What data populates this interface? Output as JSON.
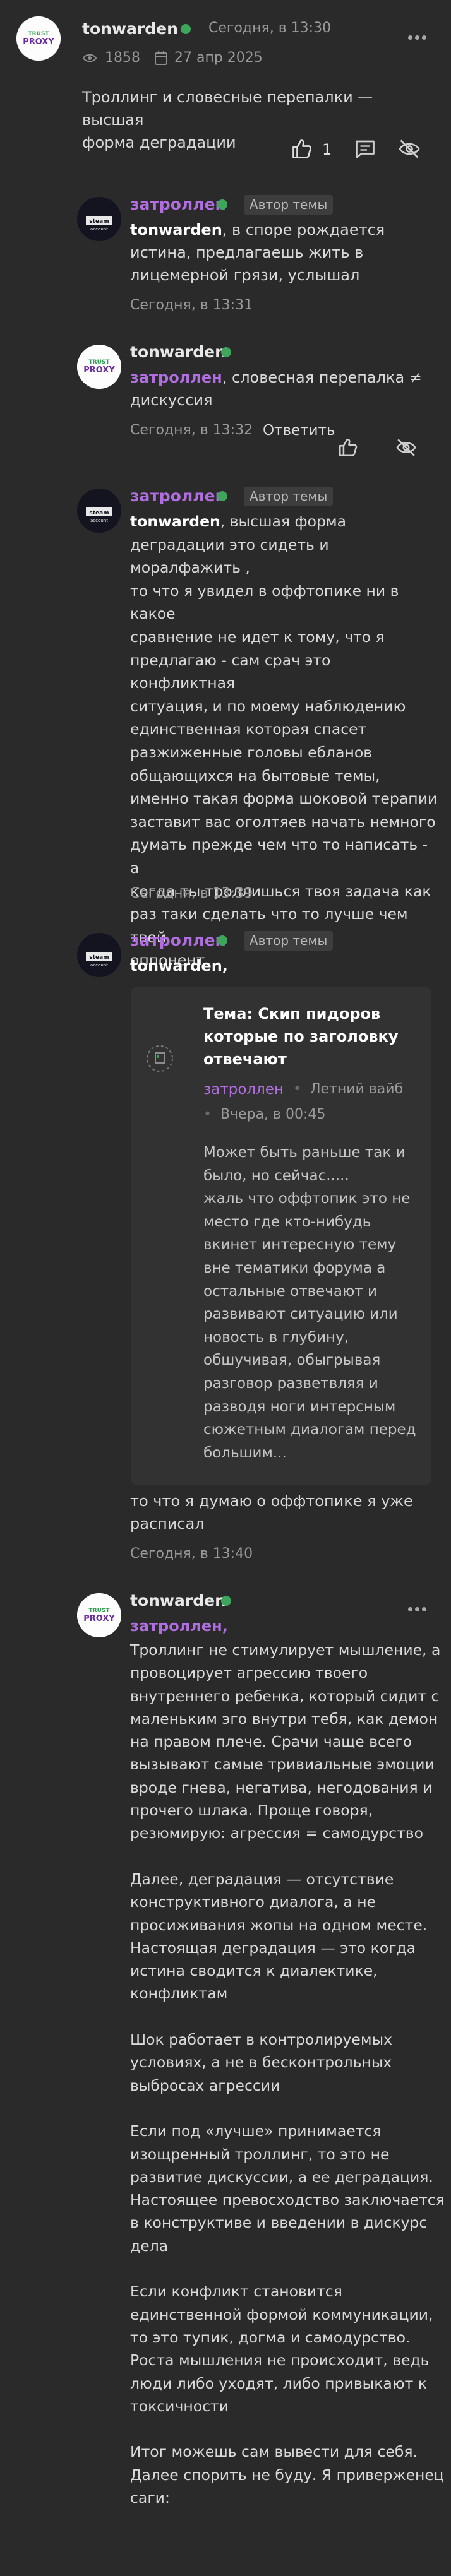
{
  "main_post": {
    "author": "tonwarden",
    "time": "Сегодня, в 13:30",
    "views": "1858",
    "date": "27 апр 2025",
    "text_lines": [
      "Троллинг и словесные перепалки — высшая",
      "форма деградации"
    ],
    "likes": "1"
  },
  "comments": [
    {
      "author": "затроллен",
      "badge": "Автор темы",
      "lines": [
        {
          "bold": "tonwarden",
          "rest": ", в споре рождается"
        },
        {
          "bold": "",
          "rest": "истина, предлагаешь жить в"
        },
        {
          "bold": "",
          "rest": "лицемерной грязи, услышал"
        }
      ],
      "time": "Сегодня, в 13:31"
    },
    {
      "author": "tonwarden",
      "lines": [
        {
          "mention": "затроллен",
          "rest": ", словесная перепалка ≠"
        },
        {
          "mention": "",
          "rest": "дискуссия"
        }
      ],
      "time": "Сегодня, в 13:32",
      "reply_label": "Ответить"
    },
    {
      "author": "затроллен",
      "badge": "Автор темы",
      "lines": [
        {
          "bold": "tonwarden",
          "rest": ", высшая форма"
        },
        {
          "bold": "",
          "rest": "деградации это сидеть и моралфажить ,"
        },
        {
          "bold": "",
          "rest": "то что я увидел в оффтопике ни в какое"
        },
        {
          "bold": "",
          "rest": "сравнение не идет к тому, что я"
        },
        {
          "bold": "",
          "rest": "предлагаю - сам срач это конфликтная"
        },
        {
          "bold": "",
          "rest": "ситуация, и по моему наблюдению"
        },
        {
          "bold": "",
          "rest": "единственная которая спасет"
        },
        {
          "bold": "",
          "rest": "разжиженные головы ебланов"
        },
        {
          "bold": "",
          "rest": "общающихся на бытовые темы,"
        },
        {
          "bold": "",
          "rest": "именно такая форма шоковой терапии"
        },
        {
          "bold": "",
          "rest": "заставит вас оголтяев начать немного"
        },
        {
          "bold": "",
          "rest": "думать прежде чем что то написать - а"
        },
        {
          "bold": "",
          "rest": "когда ты троллишься твоя задача как"
        },
        {
          "bold": "",
          "rest": "раз таки сделать что то лучше чем твой"
        },
        {
          "bold": "",
          "rest": "оппонент"
        }
      ],
      "time": "Сегодня, в 13:39"
    },
    {
      "author": "затроллен",
      "badge": "Автор темы",
      "mention": "tonwarden,",
      "quote": {
        "title_lines": [
          "Тема: Скип пидоров",
          "которые по заголовку",
          "отвечают"
        ],
        "author": "затроллен",
        "author_status": "Летний вайб",
        "time": "Вчера, в 00:45",
        "text_lines": [
          "Может быть раньше так и",
          "было, но сейчас.....",
          "жаль что оффтопик это не",
          "место где кто-нибудь",
          "вкинет интересную тему",
          "вне тематики форума а",
          "остальные отвечают и",
          "развивают ситуацию или",
          "новость в глубину,",
          "обшучивая, обыгрывая",
          "разговор разветвляя и",
          "разводя ноги интерсным",
          "сюжетным диалогам перед",
          "большим..."
        ]
      },
      "after_lines": [
        "то что я думаю о оффтопике я уже",
        "расписал"
      ],
      "time": "Сегодня, в 13:40"
    },
    {
      "author": "tonwarden",
      "mention": "затроллен,",
      "lines": [
        "Троллинг не стимулирует мышление, а",
        "провоцирует агрессию твоего",
        "внутреннего ребенка, который сидит с",
        "маленьким эго внутри тебя, как демон",
        "на правом плече. Срачи чаще всего",
        "вызывают самые тривиальные эмоции",
        "вроде гнева, негатива, негодования и",
        "прочего шлака. Проще говоря,",
        "резюмирую: агрессия = самодурство",
        "",
        "Далее, деградация — отсутствие",
        "конструктивного диалога, а не",
        "просиживания жопы на одном месте.",
        "Настоящая деградация — это когда",
        "истина сводится к диалектике,",
        "конфликтам",
        "",
        "Шок работает в контролируемых",
        "условиях, а не в бесконтрольных",
        "выбросах агрессии",
        "",
        "Если под «лучше» принимается",
        "изощренный троллинг, то это не",
        "развитие дискуссии, а ее деградация.",
        "Настоящее превосходство заключается",
        "в конструктиве и введении в дискурс",
        "дела",
        "",
        "Если конфликт становится",
        "единственной формой коммуникации,",
        "то это тупик, догма и самодурство.",
        "Роста мышления не происходит, ведь",
        "люди либо уходят, либо привыкают к",
        "токсичности",
        "",
        "Итог можешь сам вывести для себя.",
        "Далее спорить не буду. Я приверженец",
        "саги:"
      ]
    }
  ],
  "avatar_labels": {
    "proxy_top": "TRUST",
    "proxy_bottom": "PROXY",
    "steam_top": "steam",
    "steam_bottom": "account"
  },
  "colors": {
    "background": "#2a2a2a",
    "author_purple": "#b06ee0",
    "online_green": "#3ea55c",
    "proxy_green": "#2f9e4f",
    "proxy_purple": "#6a2ca0"
  },
  "icons": [
    "more-icon",
    "eye-icon",
    "calendar-icon",
    "thumbs-up-icon",
    "message-icon",
    "eye-off-icon"
  ]
}
